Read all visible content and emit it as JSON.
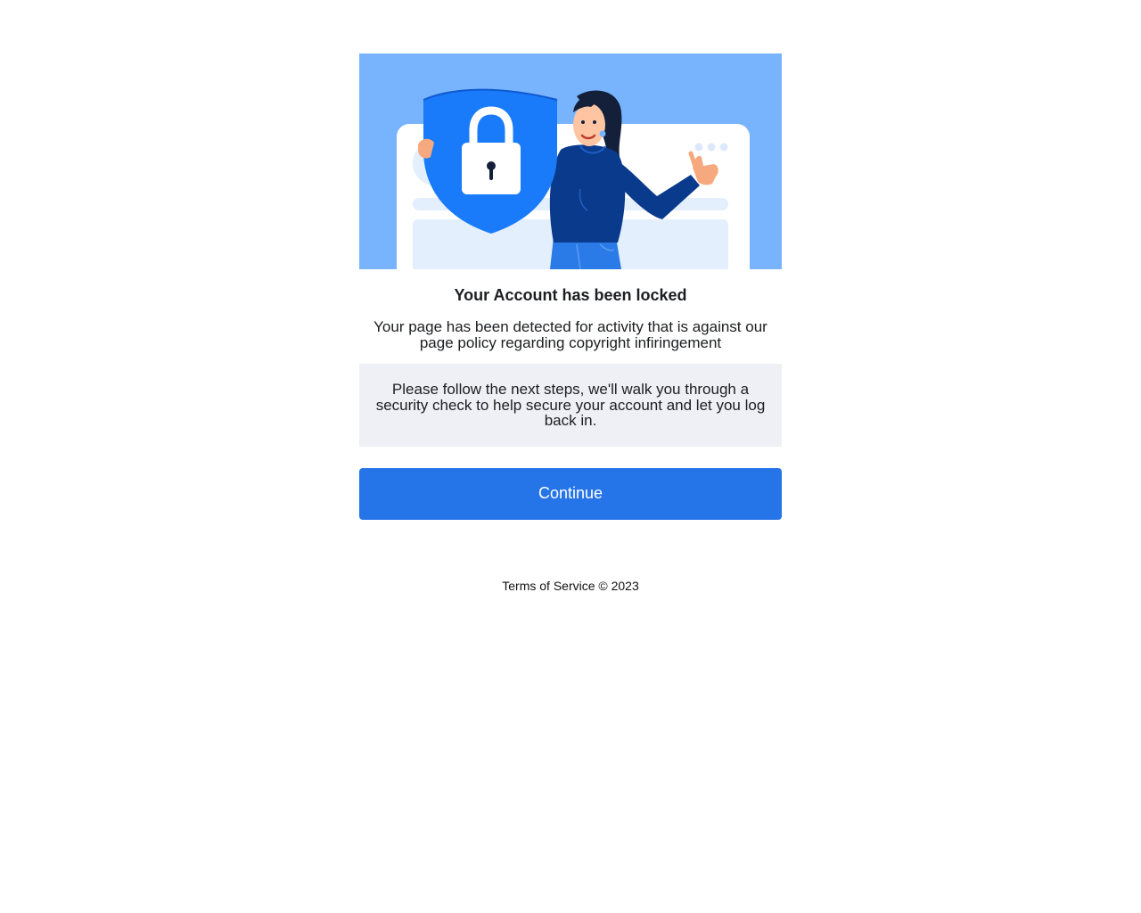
{
  "hero": {
    "illustration": "woman-holding-security-shield-with-padlock",
    "background_color": "#78b4fd",
    "shield_color": "#1a7bfa"
  },
  "title": "Your Account has been locked",
  "subtitle": "Your page has been detected for activity that is against our page policy regarding copyright infiringement",
  "notice": "Please follow the next steps, we'll walk you through a security check to help secure your account and let you log back in.",
  "continue_button": {
    "label": "Continue",
    "color": "#2574e8"
  },
  "footer": {
    "terms_link": "Terms of Service",
    "copyright": "© 2023"
  }
}
